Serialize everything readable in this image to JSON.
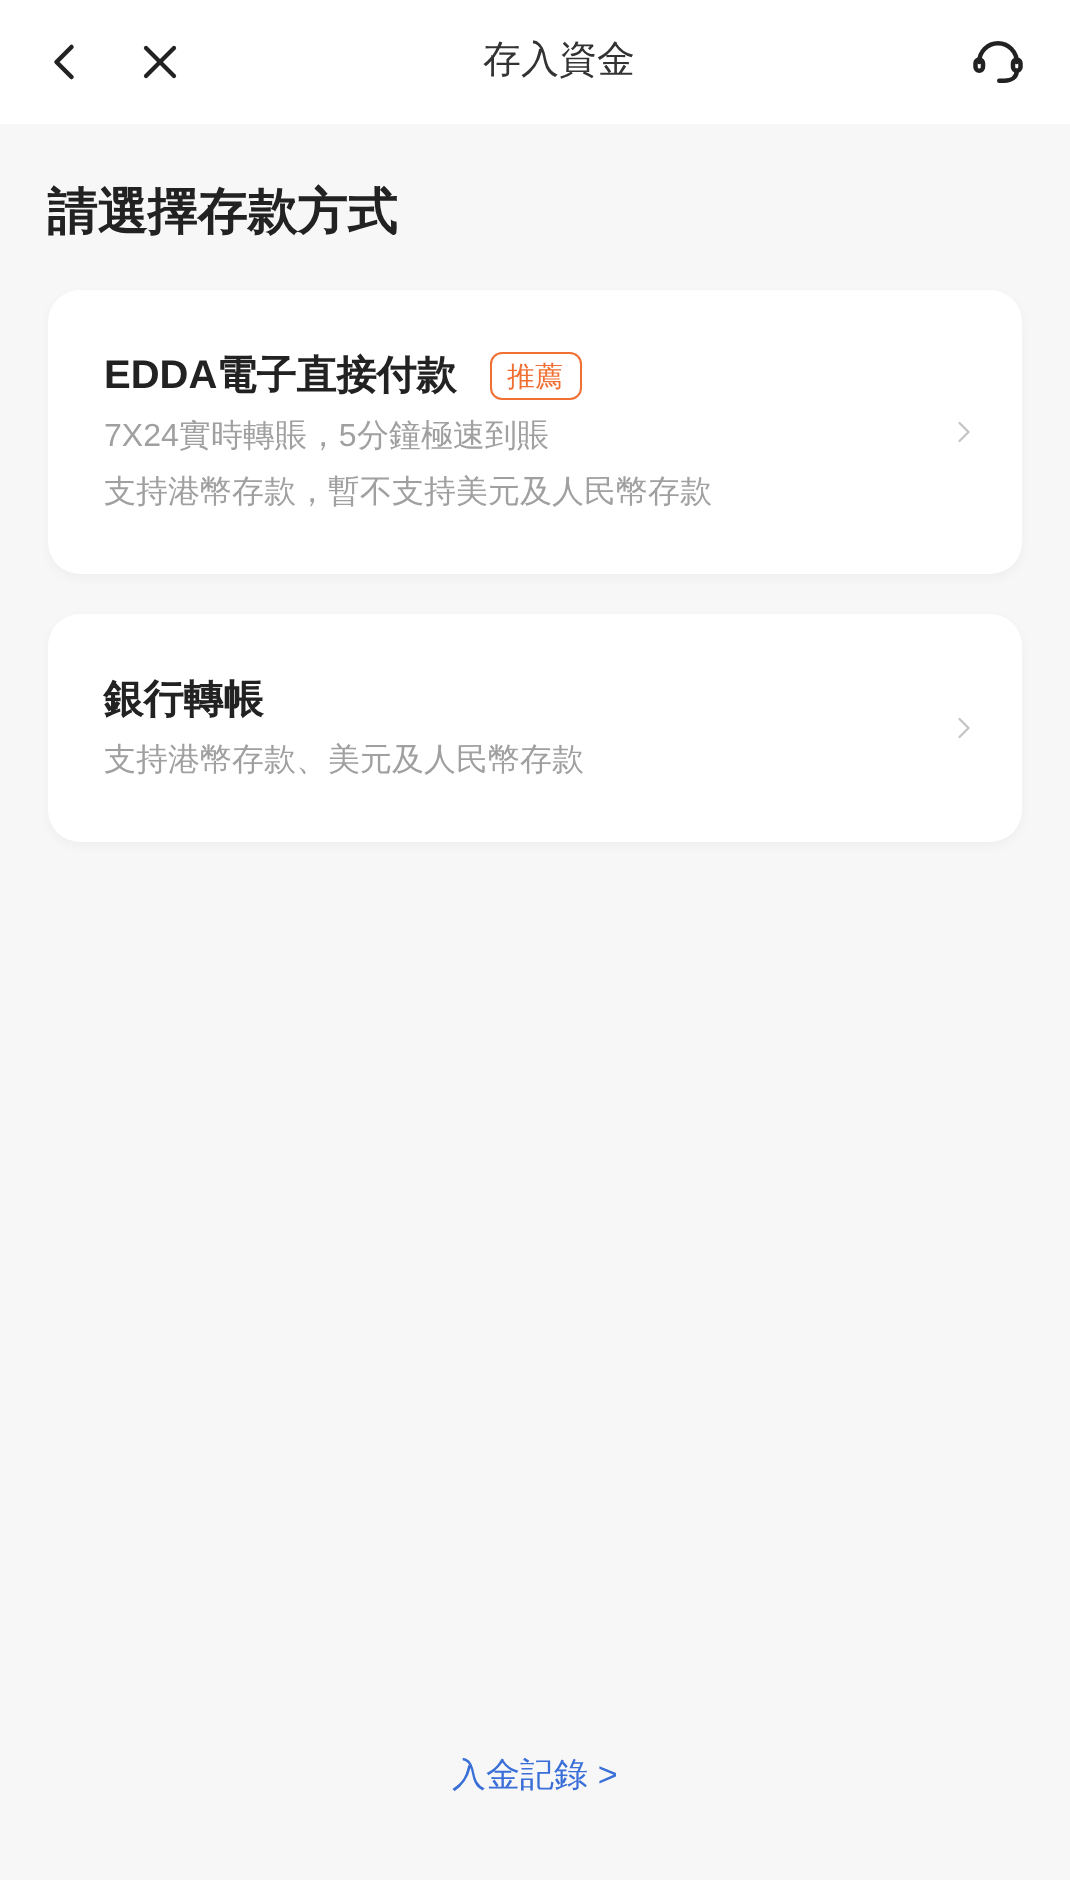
{
  "header": {
    "title": "存入資金"
  },
  "heading": "請選擇存款方式",
  "methods": [
    {
      "name": "EDDA電子直接付款",
      "badge": "推薦",
      "lines": [
        "7X24實時轉賬，5分鐘極速到賬",
        "支持港幣存款，暫不支持美元及人民幣存款"
      ]
    },
    {
      "name": "銀行轉帳",
      "lines": [
        "支持港幣存款、美元及人民幣存款"
      ]
    }
  ],
  "footer_link": "入金記錄 >"
}
